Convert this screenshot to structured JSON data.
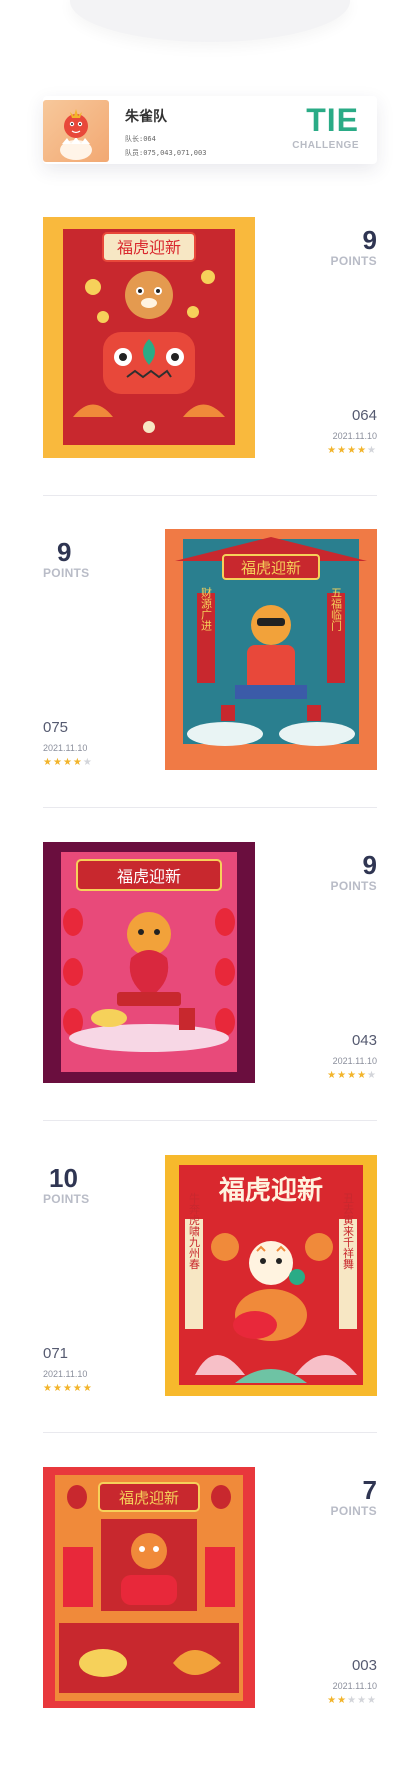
{
  "team": {
    "name": "朱雀队",
    "captain": "队长:064",
    "members": "队员:075,043,071,003",
    "result": "TIE",
    "result_sub": "CHALLENGE"
  },
  "entries": [
    {
      "points": "9",
      "points_label": "POINTS",
      "code": "064",
      "date": "2021.11.10",
      "rating": 4,
      "banner": "福虎迎新",
      "bg": "#f9b93d"
    },
    {
      "points": "9",
      "points_label": "POINTS",
      "code": "075",
      "date": "2021.11.10",
      "rating": 4,
      "banner": "福虎迎新",
      "couplet_left": "财源广进",
      "couplet_right": "五福临门",
      "bg": "#f07a45"
    },
    {
      "points": "9",
      "points_label": "POINTS",
      "code": "043",
      "date": "2021.11.10",
      "rating": 4,
      "banner": "福虎迎新",
      "bg": "#6a0e3e"
    },
    {
      "points": "10",
      "points_label": "POINTS",
      "code": "071",
      "date": "2021.11.10",
      "rating": 5,
      "banner": "福虎迎新",
      "couplet_left": "牛奔虎啸九州春",
      "couplet_right": "丑去寅来千祥舞",
      "bg": "#f7b92c"
    },
    {
      "points": "7",
      "points_label": "POINTS",
      "code": "003",
      "date": "2021.11.10",
      "rating": 2,
      "banner": "福虎迎新",
      "bg": "#e8383c"
    }
  ],
  "colors": {
    "accent": "#2aab86",
    "star_on": "#f2b42b",
    "star_off": "#d3d5da",
    "title": "#2f3552"
  }
}
